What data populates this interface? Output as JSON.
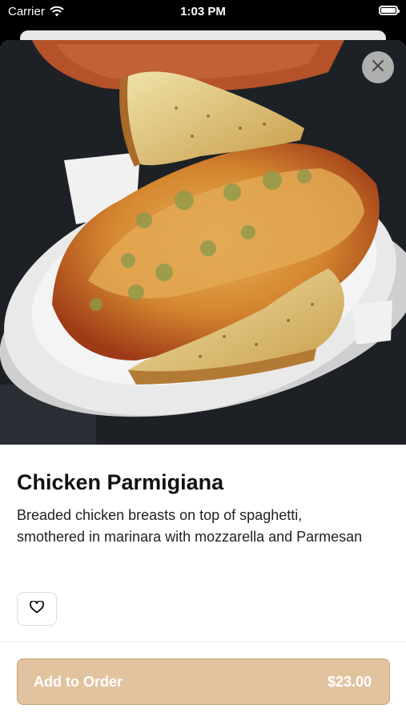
{
  "status_bar": {
    "carrier": "Carrier",
    "time": "1:03 PM"
  },
  "item": {
    "title": "Chicken Parmigiana",
    "description": "Breaded chicken breasts on top of spaghetti, smothered in marinara with mozzarella and Parmesan",
    "price": "$23.00"
  },
  "actions": {
    "add_to_order": "Add to Order"
  },
  "icons": {
    "close": "close-icon",
    "favorite": "heart-outline-icon",
    "wifi": "wifi-icon",
    "battery": "battery-icon"
  },
  "colors": {
    "accent_button": "#e2c39f",
    "accent_border": "#c9a37a"
  }
}
